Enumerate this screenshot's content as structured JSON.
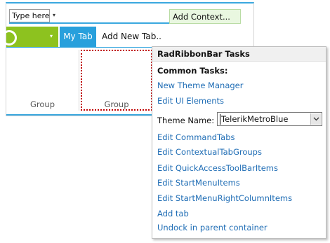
{
  "designer": {
    "qat_input_text": "Type here",
    "qat_dropdown_glyph": "▾",
    "add_context_label": "Add Context...",
    "app_button_arrow": "▾",
    "tabs": [
      {
        "label": "My Tab"
      },
      {
        "label": "Add New Tab..."
      }
    ],
    "groups": [
      {
        "label": "Group"
      },
      {
        "label": "Group"
      }
    ],
    "colors": {
      "accent_blue": "#28a0dc",
      "app_button_green": "#8dc21f",
      "selection_red": "#c00000"
    }
  },
  "tasks_panel": {
    "title": "RadRibbonBar Tasks",
    "common_tasks_heading": "Common Tasks:",
    "links_top": [
      "New Theme Manager",
      "Edit UI Elements"
    ],
    "theme_label": "Theme Name:",
    "theme_value": "TelerikMetroBlue",
    "links_bottom": [
      "Edit CommandTabs",
      "Edit ContextualTabGroups",
      "Edit QuickAccessToolBarItems",
      "Edit StartMenuItems",
      "Edit StartMenuRightColumnItems",
      "Add tab",
      "Undock in parent container"
    ],
    "link_color": "#1f6db5"
  }
}
